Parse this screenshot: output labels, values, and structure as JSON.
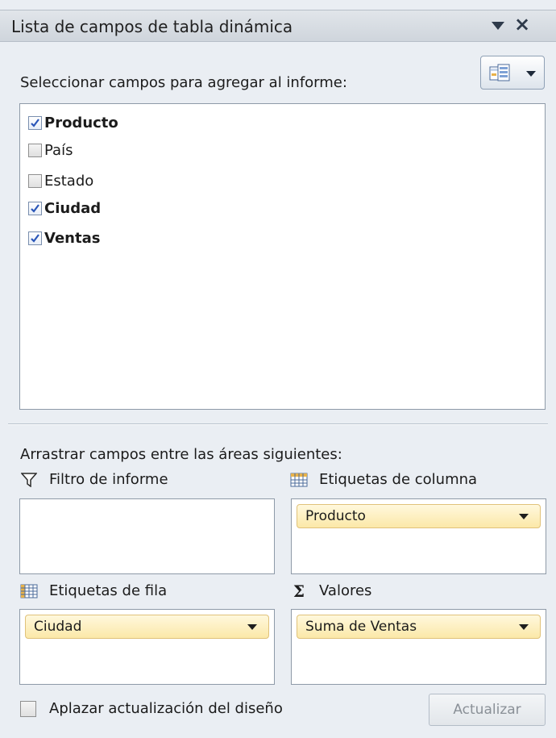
{
  "panel": {
    "title": "Lista de campos de tabla dinámica",
    "title_menu_icon": "dropdown-arrow-icon",
    "close_icon": "close-icon",
    "layout_button_icon": "field-list-layout-icon"
  },
  "fields": {
    "label": "Seleccionar campos para agregar al informe:",
    "items": [
      {
        "label": "Producto",
        "checked": true
      },
      {
        "label": "País",
        "checked": false
      },
      {
        "label": "Estado",
        "checked": false
      },
      {
        "label": "Ciudad",
        "checked": true
      },
      {
        "label": "Ventas",
        "checked": true
      }
    ]
  },
  "areas": {
    "label": "Arrastrar campos entre las áreas siguientes:",
    "report_filter": {
      "label": "Filtro de informe",
      "icon": "filter-icon",
      "items": []
    },
    "column_labels": {
      "label": "Etiquetas de columna",
      "icon": "column-grid-icon",
      "items": [
        "Producto"
      ]
    },
    "row_labels": {
      "label": "Etiquetas de fila",
      "icon": "row-grid-icon",
      "items": [
        "Ciudad"
      ]
    },
    "values": {
      "label": "Valores",
      "icon": "sigma-icon",
      "items": [
        "Suma de Ventas"
      ]
    }
  },
  "footer": {
    "defer_label": "Aplazar actualización del diseño",
    "defer_checked": false,
    "update_label": "Actualizar"
  },
  "colors": {
    "panel_bg": "#eaeef3",
    "pill_bg": "#fbe8a8",
    "pill_border": "#e0c27a",
    "check_color": "#2a56b8"
  }
}
